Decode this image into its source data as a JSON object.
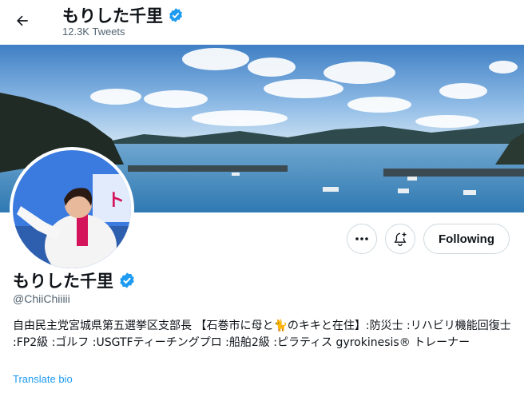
{
  "header": {
    "back_icon": "arrow-left-icon",
    "display_name": "もりした千里",
    "tweet_count": "12.3K Tweets"
  },
  "actions": {
    "more_icon": "ellipsis-icon",
    "notify_icon": "bell-plus-icon",
    "follow_label": "Following"
  },
  "profile": {
    "display_name": "もりした千里",
    "verified_icon": "verified-badge-icon",
    "handle": "@ChiiChiiiii",
    "bio_part1": "自由民主党宮城県第五選挙区支部長 【石巻市に母と",
    "bio_emoji": "🐈",
    "bio_part2": "のキキと在住】:防災士 :リハビリ機能回復士 :FP2級 :ゴルフ :USGTFティーチングプロ :船舶2級 :ピラティス gyrokinesis® トレーナー",
    "translate_label": "Translate bio"
  },
  "colors": {
    "accent": "#1d9bf0",
    "secondary_text": "#536471",
    "border": "#cfd9de"
  }
}
